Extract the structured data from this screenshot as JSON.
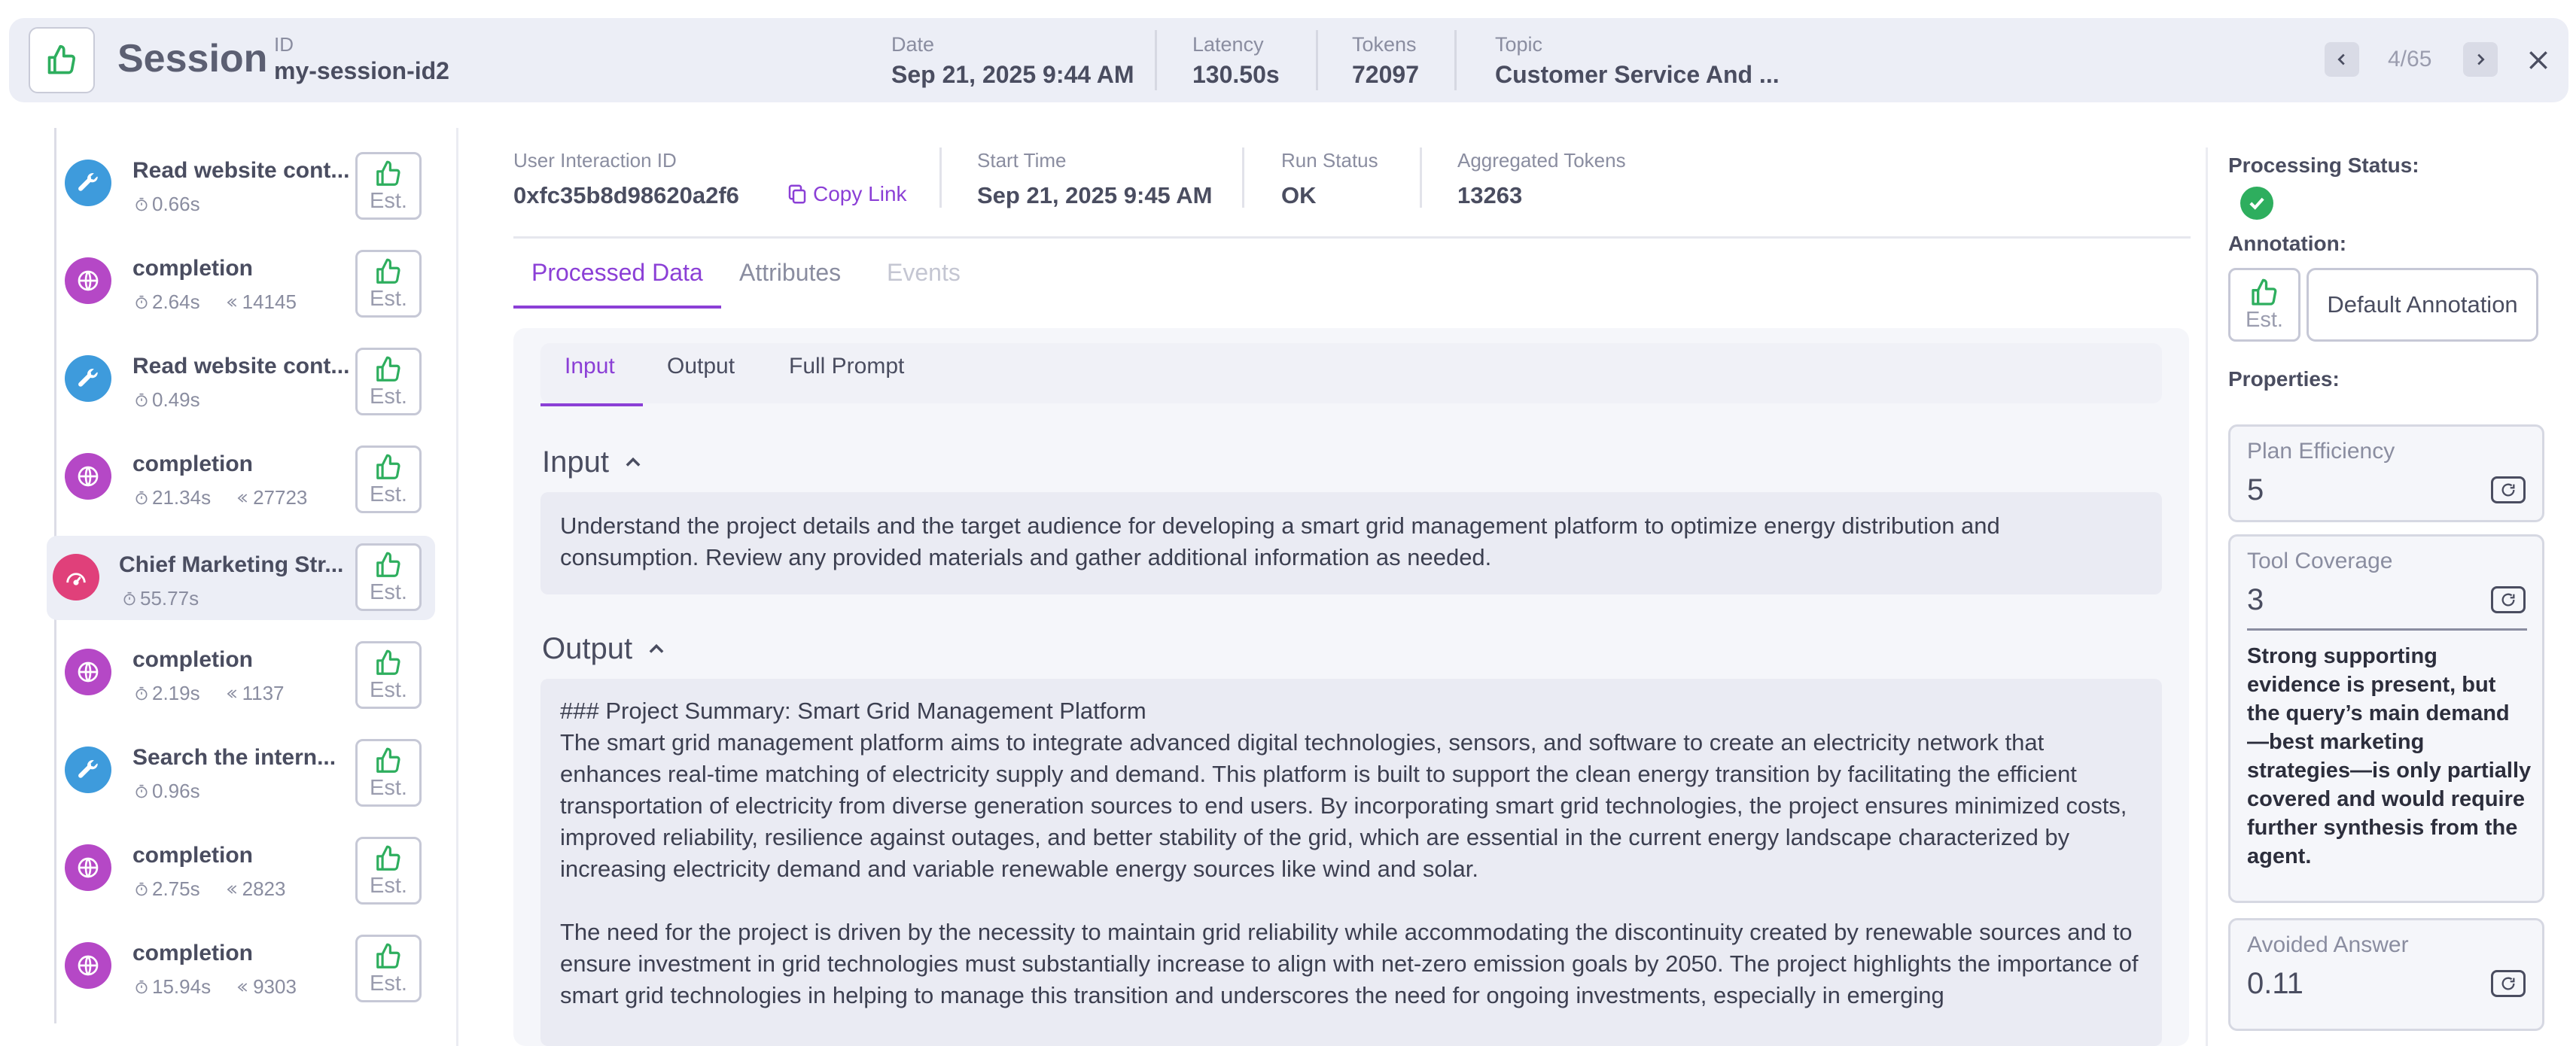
{
  "header": {
    "title": "Session",
    "id_label": "ID",
    "id_value": "my-session-id2",
    "date_label": "Date",
    "date_value": "Sep 21, 2025 9:44 AM",
    "latency_label": "Latency",
    "latency_value": "130.50s",
    "tokens_label": "Tokens",
    "tokens_value": "72097",
    "topic_label": "Topic",
    "topic_value": "Customer Service And ...",
    "pager": "4/65"
  },
  "steps": [
    {
      "title": "Read website cont...",
      "duration": "0.66s",
      "tokens": "",
      "type": "tool",
      "est": "Est."
    },
    {
      "title": "completion",
      "duration": "2.64s",
      "tokens": "14145",
      "type": "llm",
      "est": "Est."
    },
    {
      "title": "Read website cont...",
      "duration": "0.49s",
      "tokens": "",
      "type": "tool",
      "est": "Est."
    },
    {
      "title": "completion",
      "duration": "21.34s",
      "tokens": "27723",
      "type": "llm",
      "est": "Est."
    },
    {
      "title": "Chief Marketing Str...",
      "duration": "55.77s",
      "tokens": "",
      "type": "agent",
      "est": "Est."
    },
    {
      "title": "completion",
      "duration": "2.19s",
      "tokens": "1137",
      "type": "llm",
      "est": "Est."
    },
    {
      "title": "Search the intern...",
      "duration": "0.96s",
      "tokens": "",
      "type": "tool",
      "est": "Est."
    },
    {
      "title": "completion",
      "duration": "2.75s",
      "tokens": "2823",
      "type": "llm",
      "est": "Est."
    },
    {
      "title": "completion",
      "duration": "15.94s",
      "tokens": "9303",
      "type": "llm",
      "est": "Est."
    }
  ],
  "main": {
    "uid_label": "User Interaction ID",
    "uid_value": "0xfc35b8d98620a2f6",
    "copy_link": "Copy Link",
    "start_label": "Start Time",
    "start_value": "Sep 21, 2025 9:45 AM",
    "status_label": "Run Status",
    "status_value": "OK",
    "agg_label": "Aggregated Tokens",
    "agg_value": "13263",
    "tabs": [
      "Processed Data",
      "Attributes",
      "Events"
    ],
    "subtabs": [
      "Input",
      "Output",
      "Full Prompt"
    ],
    "input_heading": "Input",
    "input_text": "Understand the project details and the target audience for developing a smart grid management platform to optimize energy distribution and consumption. Review any provided materials and gather additional information as needed.",
    "output_heading": "Output",
    "output_title": "### Project Summary: Smart Grid Management Platform",
    "output_p1": "The smart grid management platform aims to integrate advanced digital technologies, sensors, and software to create an electricity network that enhances real-time matching of electricity supply and demand. This platform is built to support the clean energy transition by facilitating the efficient transportation of electricity from diverse generation sources to end users. By incorporating smart grid technologies, the project ensures minimized costs, improved reliability, resilience against outages, and better stability of the grid, which are essential in the current energy landscape characterized by increasing electricity demand and variable renewable energy sources like wind and solar.",
    "output_p2": "The need for the project is driven by the necessity to maintain grid reliability while accommodating the discontinuity created by renewable sources and to ensure investment in grid technologies must substantially increase to align with net-zero emission goals by 2050. The project highlights the importance of smart grid technologies in helping to manage this transition and underscores the need for ongoing investments, especially in emerging"
  },
  "right": {
    "processing_label": "Processing Status:",
    "annotation_label": "Annotation:",
    "est": "Est.",
    "default_annotation": "Default Annotation",
    "properties_label": "Properties:",
    "props": [
      {
        "label": "Plan Efficiency",
        "value": "5"
      },
      {
        "label": "Tool Coverage",
        "value": "3",
        "explanation": "Strong supporting evidence is present, but the query’s main demand —best marketing strategies—is only partially covered and would require further synthesis from the agent."
      },
      {
        "label": "Avoided Answer",
        "value": "0.11"
      }
    ]
  },
  "colors": {
    "accent": "#8b3fd6",
    "ok_green": "#2eae5e",
    "tool_blue": "#3e9bdc",
    "llm_purple": "#b548c6",
    "agent_pink": "#e0407a"
  }
}
